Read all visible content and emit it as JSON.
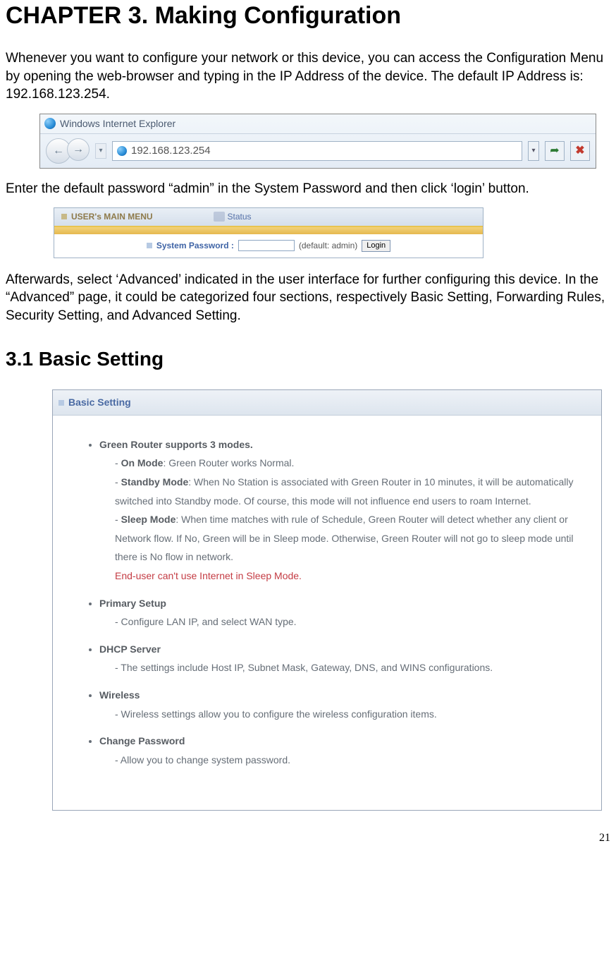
{
  "chapter_title": "CHAPTER 3. Making Configuration",
  "para1": "Whenever you want to configure your network or this device, you can access the Configuration Menu by opening the web-browser and typing in the IP Address of the device. The default IP Address is: 192.168.123.254.",
  "ie": {
    "title": "Windows Internet Explorer",
    "url": "192.168.123.254"
  },
  "para2": "Enter the default password “admin” in the System Password and then click ‘login’ button.",
  "login": {
    "menu": "USER's MAIN MENU",
    "status": "Status",
    "label": "System Password :",
    "default": "(default: admin)",
    "button": "Login"
  },
  "para3": "Afterwards, select ‘Advanced’ indicated in the user interface for further configuring this device. In the “Advanced” page, it could be categorized four sections, respectively Basic Setting, Forwarding Rules, Security Setting, and Advanced Setting.",
  "section_title": "3.1 Basic Setting",
  "basic": {
    "header": "Basic Setting",
    "modes_title": "Green Router supports 3 modes.",
    "on_label": "On Mode",
    "on_text": ": Green Router works Normal.",
    "standby_label": "Standby Mode",
    "standby_text": ": When No Station is associated with Green Router in 10 minutes, it will be automatically switched into Standby mode. Of course, this mode will not influence end users to roam Internet.",
    "sleep_label": "Sleep Mode",
    "sleep_text": ": When time matches with rule of Schedule, Green Router will detect whether any client or Network flow. If No, Green will be in Sleep mode. Otherwise, Green Router will not go to sleep mode until there is No flow in network.",
    "sleep_warn": "End-user can't use Internet in Sleep Mode.",
    "primary_title": "Primary Setup",
    "primary_text": "- Configure LAN IP, and select WAN type.",
    "dhcp_title": "DHCP Server",
    "dhcp_text": "- The settings include Host IP, Subnet Mask, Gateway, DNS, and WINS configurations.",
    "wireless_title": "Wireless",
    "wireless_text": "- Wireless settings allow you to configure the wireless configuration items.",
    "chpw_title": "Change Password",
    "chpw_text": "- Allow you to change system password."
  },
  "page_number": "21"
}
